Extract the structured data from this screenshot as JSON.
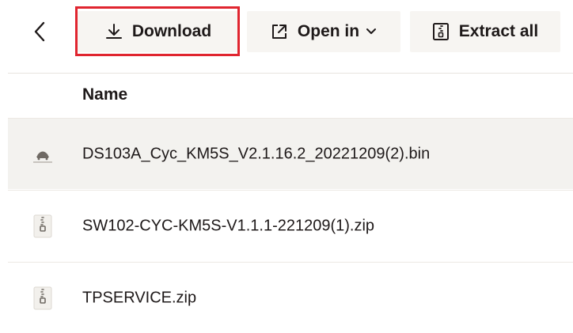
{
  "toolbar": {
    "download_label": "Download",
    "open_in_label": "Open in",
    "extract_all_label": "Extract all"
  },
  "table": {
    "column_header": "Name",
    "rows": [
      {
        "name": "DS103A_Cyc_KM5S_V2.1.16.2_20221209(2).bin",
        "icon": "binary-file-icon",
        "selected": true
      },
      {
        "name": "SW102-CYC-KM5S-V1.1.1-221209(1).zip",
        "icon": "zip-file-icon",
        "selected": false
      },
      {
        "name": "TPSERVICE.zip",
        "icon": "zip-file-icon",
        "selected": false
      }
    ]
  },
  "colors": {
    "button_bg": "#f7f5f2",
    "highlight_border": "#e0252f",
    "selected_row_bg": "#f3f2ef",
    "text": "#1e1919"
  }
}
